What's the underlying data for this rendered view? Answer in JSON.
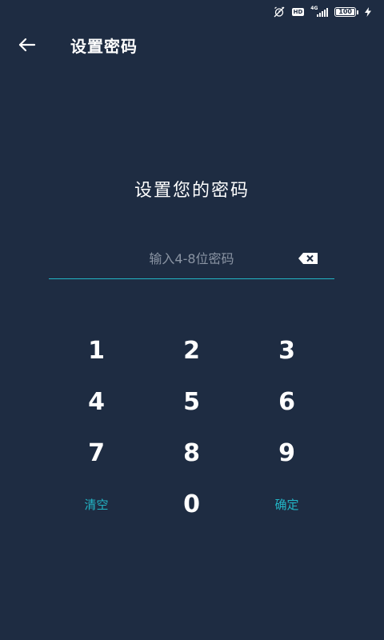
{
  "status_bar": {
    "hd_label": "HD",
    "network_label": "4G",
    "battery_level": "100"
  },
  "app_bar": {
    "title": "设置密码",
    "back_icon": "arrow-left-icon"
  },
  "heading": "设置您的密码",
  "pin_input": {
    "value": "",
    "placeholder": "输入4-8位密码",
    "delete_icon": "backspace-icon"
  },
  "keypad": {
    "keys": [
      {
        "label": "1",
        "name": "key-1",
        "type": "digit"
      },
      {
        "label": "2",
        "name": "key-2",
        "type": "digit"
      },
      {
        "label": "3",
        "name": "key-3",
        "type": "digit"
      },
      {
        "label": "4",
        "name": "key-4",
        "type": "digit"
      },
      {
        "label": "5",
        "name": "key-5",
        "type": "digit"
      },
      {
        "label": "6",
        "name": "key-6",
        "type": "digit"
      },
      {
        "label": "7",
        "name": "key-7",
        "type": "digit"
      },
      {
        "label": "8",
        "name": "key-8",
        "type": "digit"
      },
      {
        "label": "9",
        "name": "key-9",
        "type": "digit"
      },
      {
        "label": "清空",
        "name": "clear-button",
        "type": "action"
      },
      {
        "label": "0",
        "name": "key-0",
        "type": "digit"
      },
      {
        "label": "确定",
        "name": "confirm-button",
        "type": "action"
      }
    ]
  },
  "colors": {
    "background": "#1e2c42",
    "accent": "#22b5c5",
    "text": "#ffffff",
    "placeholder": "#8a94a3"
  }
}
